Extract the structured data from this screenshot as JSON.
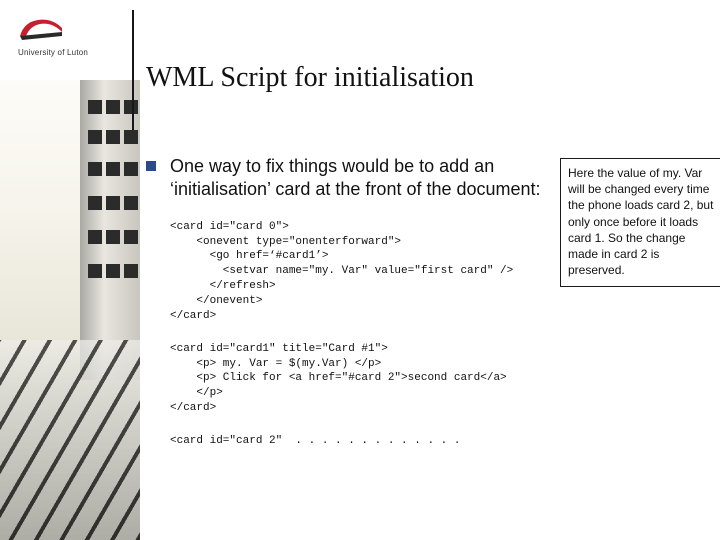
{
  "logo": {
    "text": "University of Luton"
  },
  "title": "WML Script for initialisation",
  "bullet": "One way to fix things would be to add an ‘initialisation’ card at the front of the document:",
  "code1": "<card id=\"card 0\">\n    <onevent type=\"onenterforward\">\n      <go href=‘#card1’>\n        <setvar name=\"my. Var\" value=\"first card\" />\n      </refresh>\n    </onevent>\n</card>",
  "code2": "<card id=\"card1\" title=\"Card #1\">\n    <p> my. Var = $(my.Var) </p>\n    <p> Click for <a href=\"#card 2\">second card</a>\n    </p>\n</card>",
  "code3": "<card id=\"card 2\"  . . . . . . . . . . . . .",
  "sidenote": "Here the value of my. Var will be changed every time the phone loads card 2, but only once before it loads card 1. So the change made in card 2 is preserved."
}
